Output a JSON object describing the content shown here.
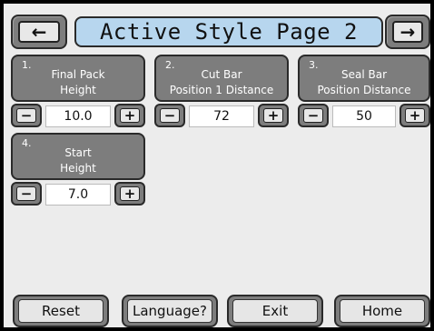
{
  "header": {
    "title": "Active Style Page 2",
    "prev_icon": "←",
    "next_icon": "→"
  },
  "params": [
    {
      "number": "1.",
      "label": "Final Pack\nHeight",
      "value": "10.0"
    },
    {
      "number": "2.",
      "label": "Cut Bar\nPosition 1 Distance",
      "value": "72"
    },
    {
      "number": "3.",
      "label": "Seal Bar\nPosition Distance",
      "value": "50"
    },
    {
      "number": "4.",
      "label": "Start\nHeight",
      "value": "7.0"
    }
  ],
  "stepper": {
    "minus": "−",
    "plus": "+"
  },
  "footer": {
    "reset": "Reset",
    "language": "Language?",
    "exit": "Exit",
    "home": "Home"
  },
  "colors": {
    "title_bg": "#b7d6ee",
    "button_gray": "#7d7d7d",
    "screen_bg": "#ececec"
  }
}
